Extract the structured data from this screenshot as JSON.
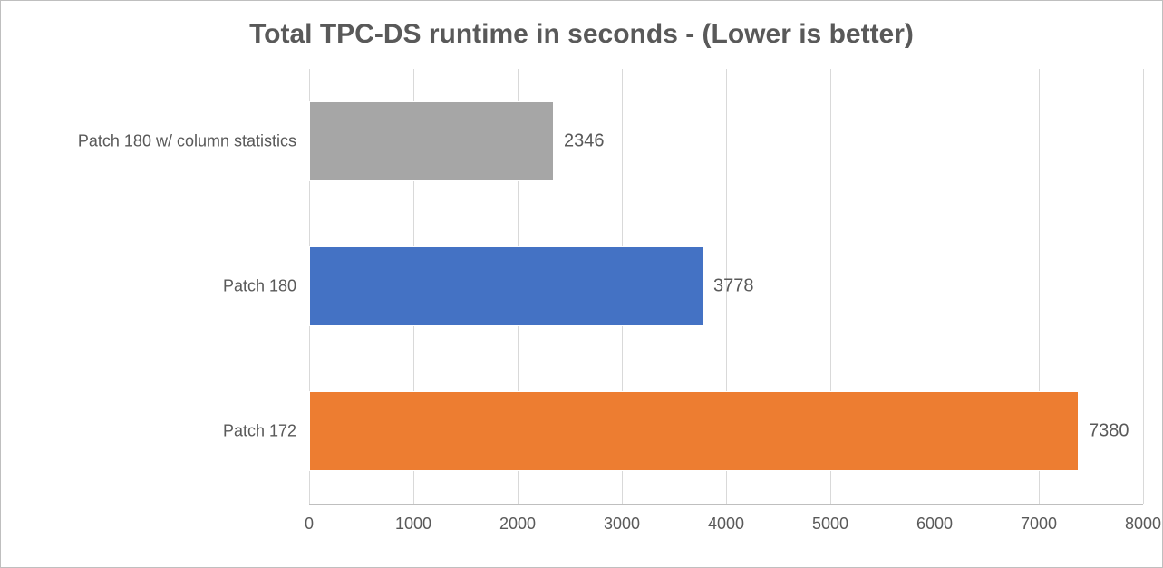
{
  "chart_data": {
    "type": "bar",
    "orientation": "horizontal",
    "title": "Total TPC-DS runtime in seconds - (Lower is better)",
    "xlabel": "",
    "ylabel": "",
    "categories": [
      "Patch 180 w/ column statistics",
      "Patch 180",
      "Patch 172"
    ],
    "values": [
      2346,
      3778,
      7380
    ],
    "colors": [
      "#a6a6a6",
      "#4472c4",
      "#ed7d31"
    ],
    "xlim": [
      0,
      8000
    ],
    "x_ticks": [
      0,
      1000,
      2000,
      3000,
      4000,
      5000,
      6000,
      7000,
      8000
    ]
  }
}
